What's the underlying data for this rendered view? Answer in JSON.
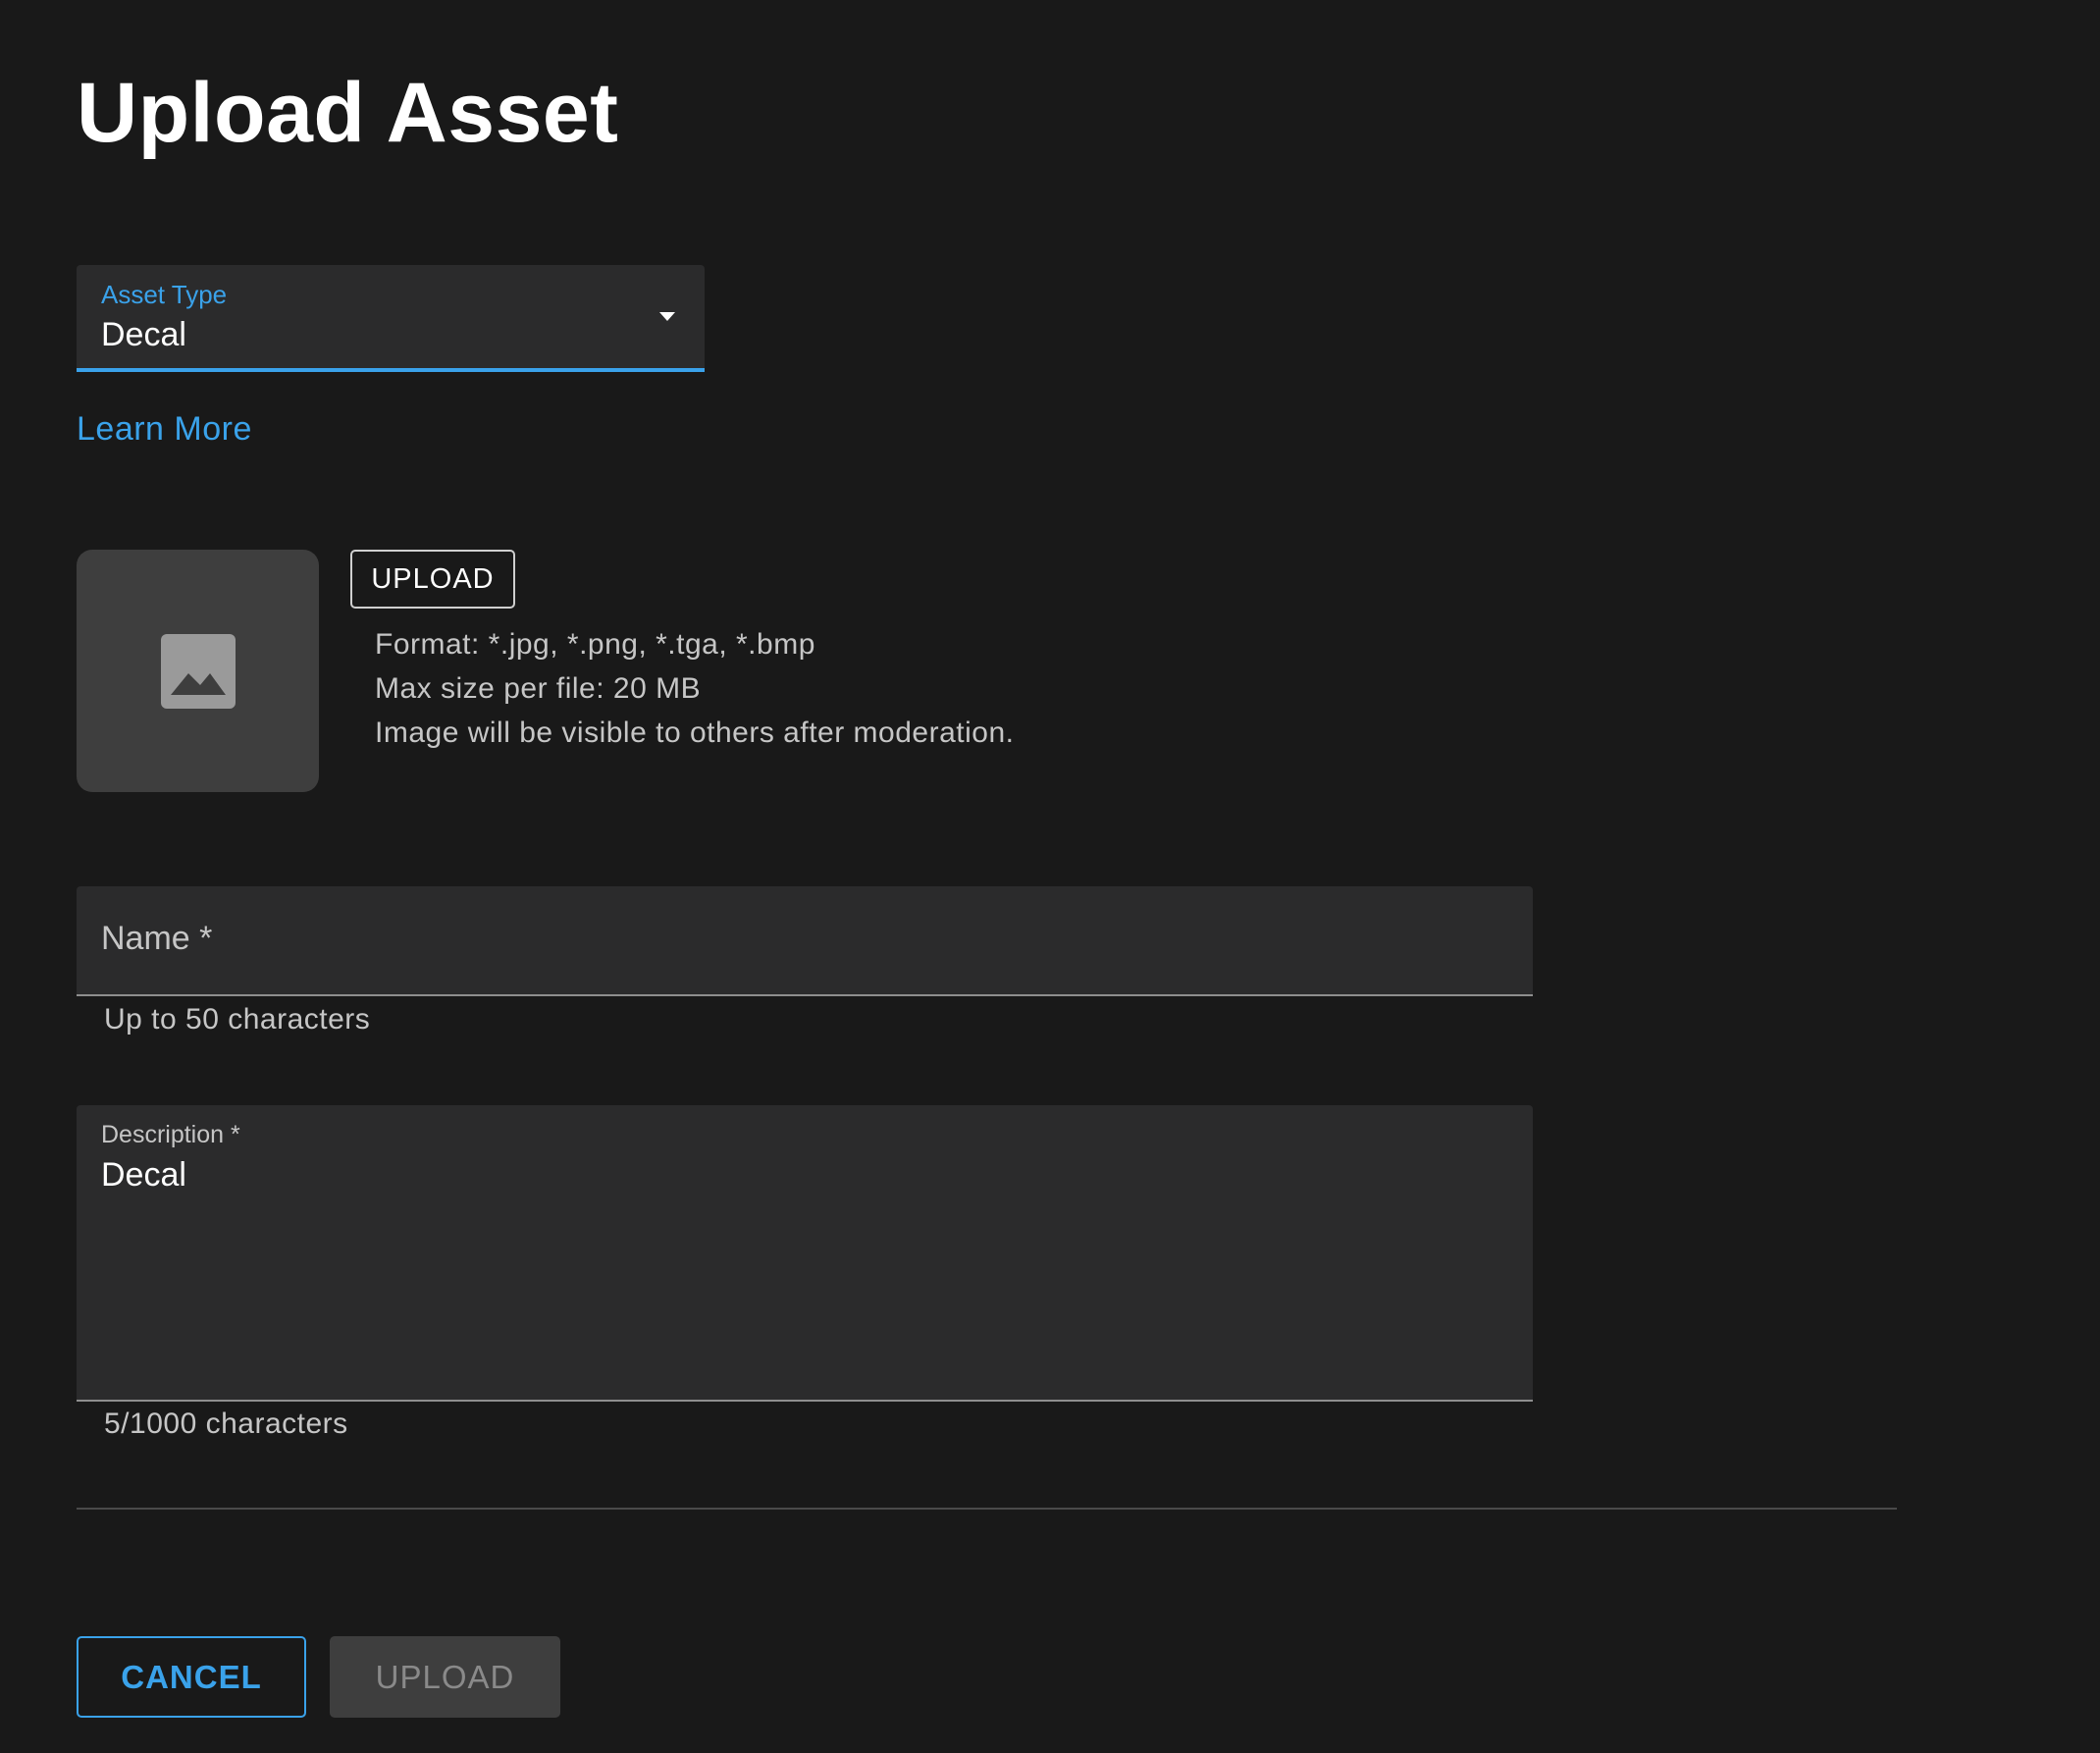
{
  "page": {
    "title": "Upload Asset"
  },
  "asset_type": {
    "label": "Asset Type",
    "value": "Decal",
    "icon": "caret-down-icon"
  },
  "learn_more": {
    "label": "Learn More"
  },
  "image_upload": {
    "icon": "image-icon",
    "button_label": "UPLOAD",
    "info": [
      "Format: *.jpg, *.png, *.tga, *.bmp",
      "Max size per file: 20 MB",
      "Image will be visible to others after moderation."
    ]
  },
  "name_field": {
    "placeholder": "Name *",
    "value": "",
    "helper": "Up to 50 characters"
  },
  "description_field": {
    "label": "Description *",
    "value": "Decal",
    "helper": "5/1000 characters"
  },
  "footer": {
    "cancel_label": "CANCEL",
    "upload_label": "UPLOAD"
  },
  "colors": {
    "background": "#191919",
    "field_background": "#2b2b2c",
    "accent": "#3aa2ea",
    "muted_text": "#c6c6c6",
    "disabled_button": "#3e3e3e"
  }
}
